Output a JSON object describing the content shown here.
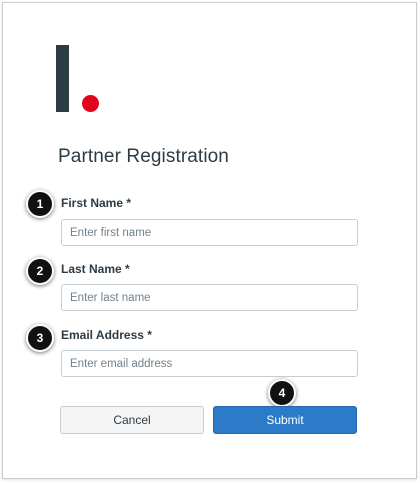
{
  "form": {
    "title": "Partner Registration",
    "fields": [
      {
        "label": "First Name *",
        "placeholder": "Enter first name",
        "value": ""
      },
      {
        "label": "Last Name *",
        "placeholder": "Enter last name",
        "value": ""
      },
      {
        "label": "Email Address *",
        "placeholder": "Enter email address",
        "value": ""
      }
    ],
    "cancel_label": "Cancel",
    "submit_label": "Submit"
  },
  "callouts": [
    "1",
    "2",
    "3",
    "4"
  ],
  "colors": {
    "logo_dark": "#2d3b45",
    "logo_dot": "#e0061f",
    "submit_bg": "#2d7bc8",
    "badge_bg": "#111111"
  },
  "icons": {
    "logo": "brand-logo-icon"
  }
}
